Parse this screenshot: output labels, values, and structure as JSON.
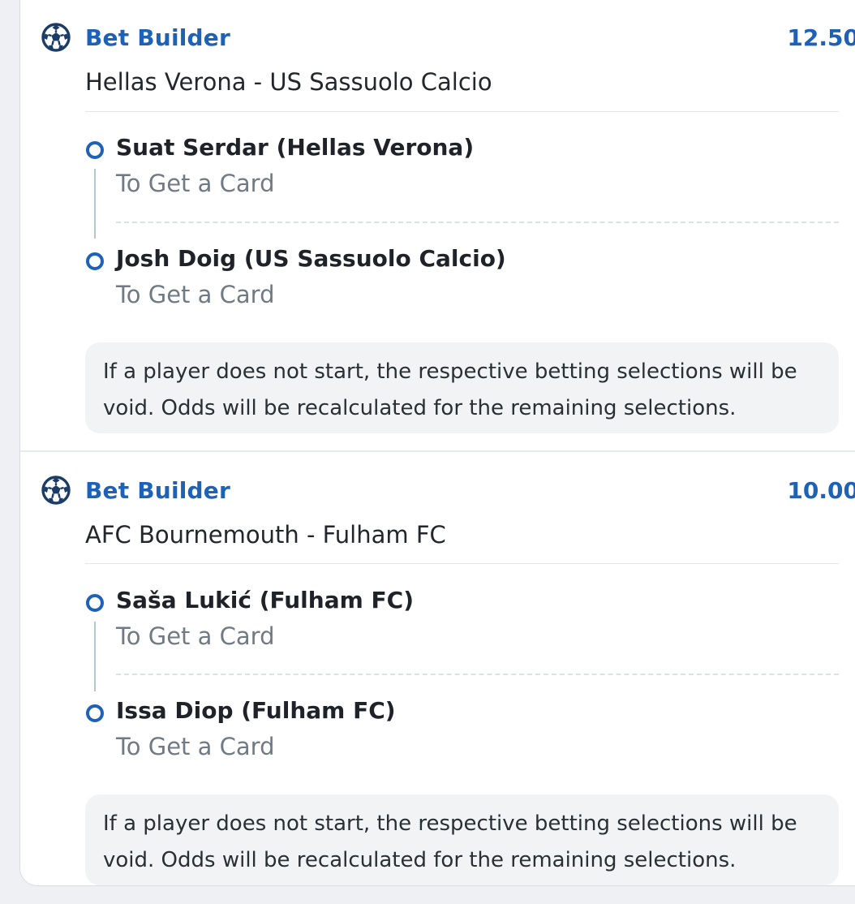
{
  "colors": {
    "accent": "#1e62b8",
    "muted_text": "#707a85",
    "note_background": "#f1f3f5"
  },
  "bets": [
    {
      "icon": "soccer-ball-icon",
      "title": "Bet Builder",
      "odds": "12.50",
      "match": "Hellas Verona - US Sassuolo Calcio",
      "selections": [
        {
          "player": "Suat Serdar (Hellas Verona)",
          "market": "To Get a Card"
        },
        {
          "player": "Josh Doig (US Sassuolo Calcio)",
          "market": "To Get a Card"
        }
      ],
      "note": "If a player does not start, the respective betting selections will be void. Odds will be recalculated for the remaining selections."
    },
    {
      "icon": "soccer-ball-icon",
      "title": "Bet Builder",
      "odds": "10.00",
      "match": "AFC Bournemouth - Fulham FC",
      "selections": [
        {
          "player": "Saša Lukić (Fulham FC)",
          "market": "To Get a Card"
        },
        {
          "player": "Issa Diop (Fulham FC)",
          "market": "To Get a Card"
        }
      ],
      "note": "If a player does not start, the respective betting selections will be void. Odds will be recalculated for the remaining selections."
    }
  ]
}
